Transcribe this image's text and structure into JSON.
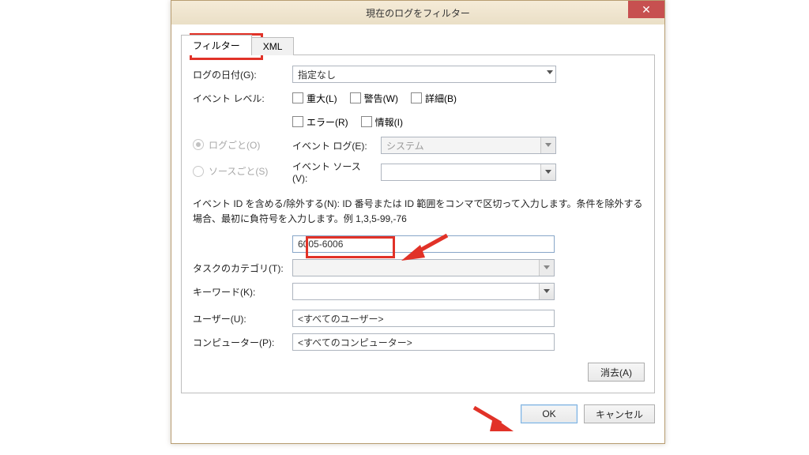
{
  "window": {
    "title": "現在のログをフィルター"
  },
  "tabs": {
    "filter": "フィルター",
    "xml": "XML"
  },
  "labels": {
    "logged": "ログの日付(G):",
    "level": "イベント レベル:",
    "byLog": "ログごと(O)",
    "bySource": "ソースごと(S)",
    "eventLog": "イベント ログ(E):",
    "eventSource": "イベント ソース(V):",
    "taskCategory": "タスクのカテゴリ(T):",
    "keywords": "キーワード(K):",
    "user": "ユーザー(U):",
    "computer": "コンピューター(P):"
  },
  "checks": {
    "critical": "重大(L)",
    "warning": "警告(W)",
    "verbose": "詳細(B)",
    "error": "エラー(R)",
    "info": "情報(I)"
  },
  "values": {
    "loggedSelected": "指定なし",
    "eventLogSelected": "システム",
    "eventId": "6005-6006",
    "userValue": "<すべてのユーザー>",
    "computerValue": "<すべてのコンピューター>"
  },
  "help": "イベント ID を含める/除外する(N): ID 番号または ID 範囲をコンマで区切って入力します。条件を除外する場合、最初に負符号を入力します。例 1,3,5-99,-76",
  "buttons": {
    "clear": "消去(A)",
    "ok": "OK",
    "cancel": "キャンセル"
  }
}
